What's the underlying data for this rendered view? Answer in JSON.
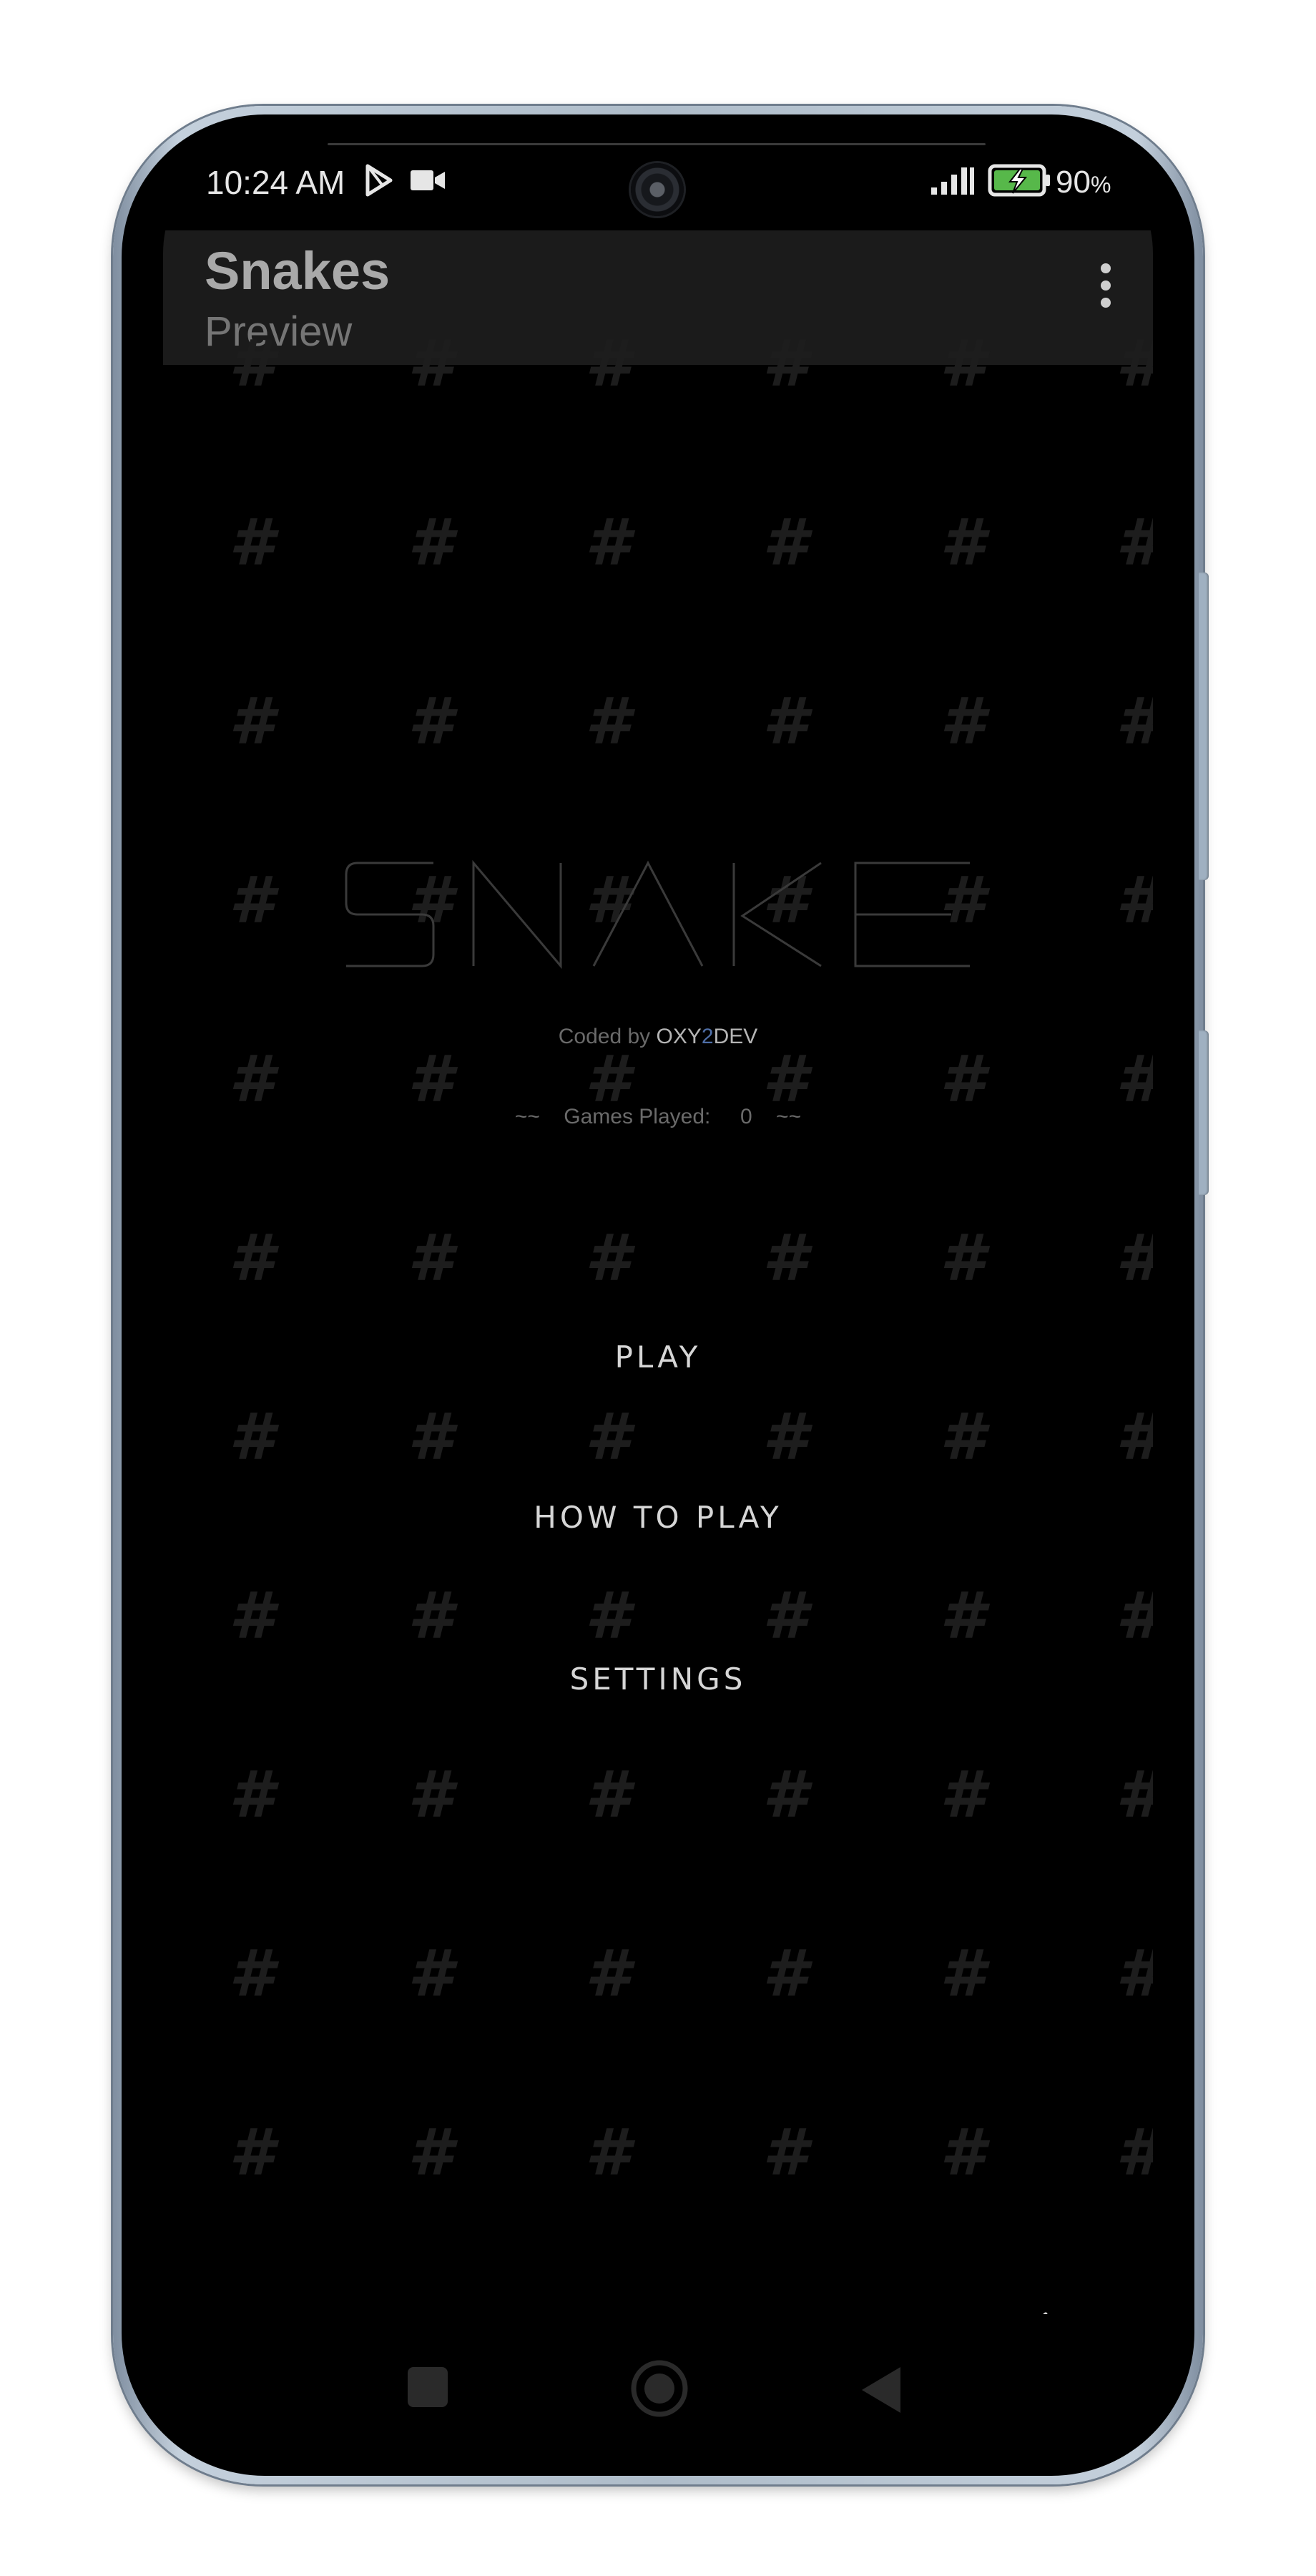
{
  "status_bar": {
    "time": "10:24 AM",
    "battery_percent": "90",
    "battery_unit": "%",
    "icons": [
      "play-store-icon",
      "video-camera-icon",
      "signal-icon",
      "battery-charging-icon"
    ]
  },
  "app_bar": {
    "title": "Snakes",
    "subtitle": "Preview",
    "overflow_icon": "more-vert-icon"
  },
  "game": {
    "logo_text": "SNAKE",
    "credit_prefix": "Coded by",
    "credit_brand_part1": "OXY",
    "credit_brand_part2": "2",
    "credit_brand_part3": "DEV",
    "games_played_label": "~~    Games Played:     0    ~~",
    "menu": {
      "play": "PLAY",
      "how_to_play": "HOW TO PLAY",
      "settings": "SETTINGS"
    },
    "background_symbol": "#",
    "mute_icon": "speaker-muted-icon"
  },
  "nav_bar": {
    "icons": [
      "recents-square-icon",
      "home-circle-icon",
      "back-triangle-icon"
    ]
  },
  "colors": {
    "background": "#000000",
    "app_bar": "#1b1b1b",
    "menu_text": "#d6d6d6",
    "brand_accent": "#4f6fa8"
  }
}
